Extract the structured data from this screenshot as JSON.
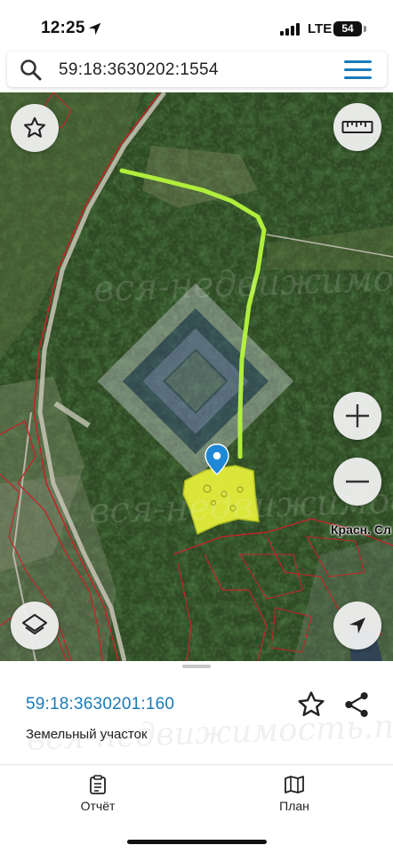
{
  "status_bar": {
    "time": "12:25",
    "network": "LTE",
    "battery": "54"
  },
  "search": {
    "query": "59:18:3630202:1554"
  },
  "map": {
    "place_label": "Красн. Сл",
    "watermark": "вся-недвижимость.net",
    "buttons": {
      "favorite": "star-icon",
      "ruler": "ruler-icon",
      "zoom_in": "plus-icon",
      "zoom_out": "minus-icon",
      "layers": "layers-icon",
      "locate": "location-arrow-icon"
    },
    "colors": {
      "route": "#b6f53c",
      "parcel_fill": "#e8f23a",
      "boundaries": "#c0262a"
    }
  },
  "sheet": {
    "parcel_id": "59:18:3630201:160",
    "parcel_type": "Земельный участок",
    "nav": [
      {
        "label": "Отчёт",
        "icon": "clipboard-icon"
      },
      {
        "label": "План",
        "icon": "map-icon"
      }
    ]
  },
  "colors": {
    "link": "#1a7bb9",
    "accent_menu": "#1a7bb9"
  }
}
